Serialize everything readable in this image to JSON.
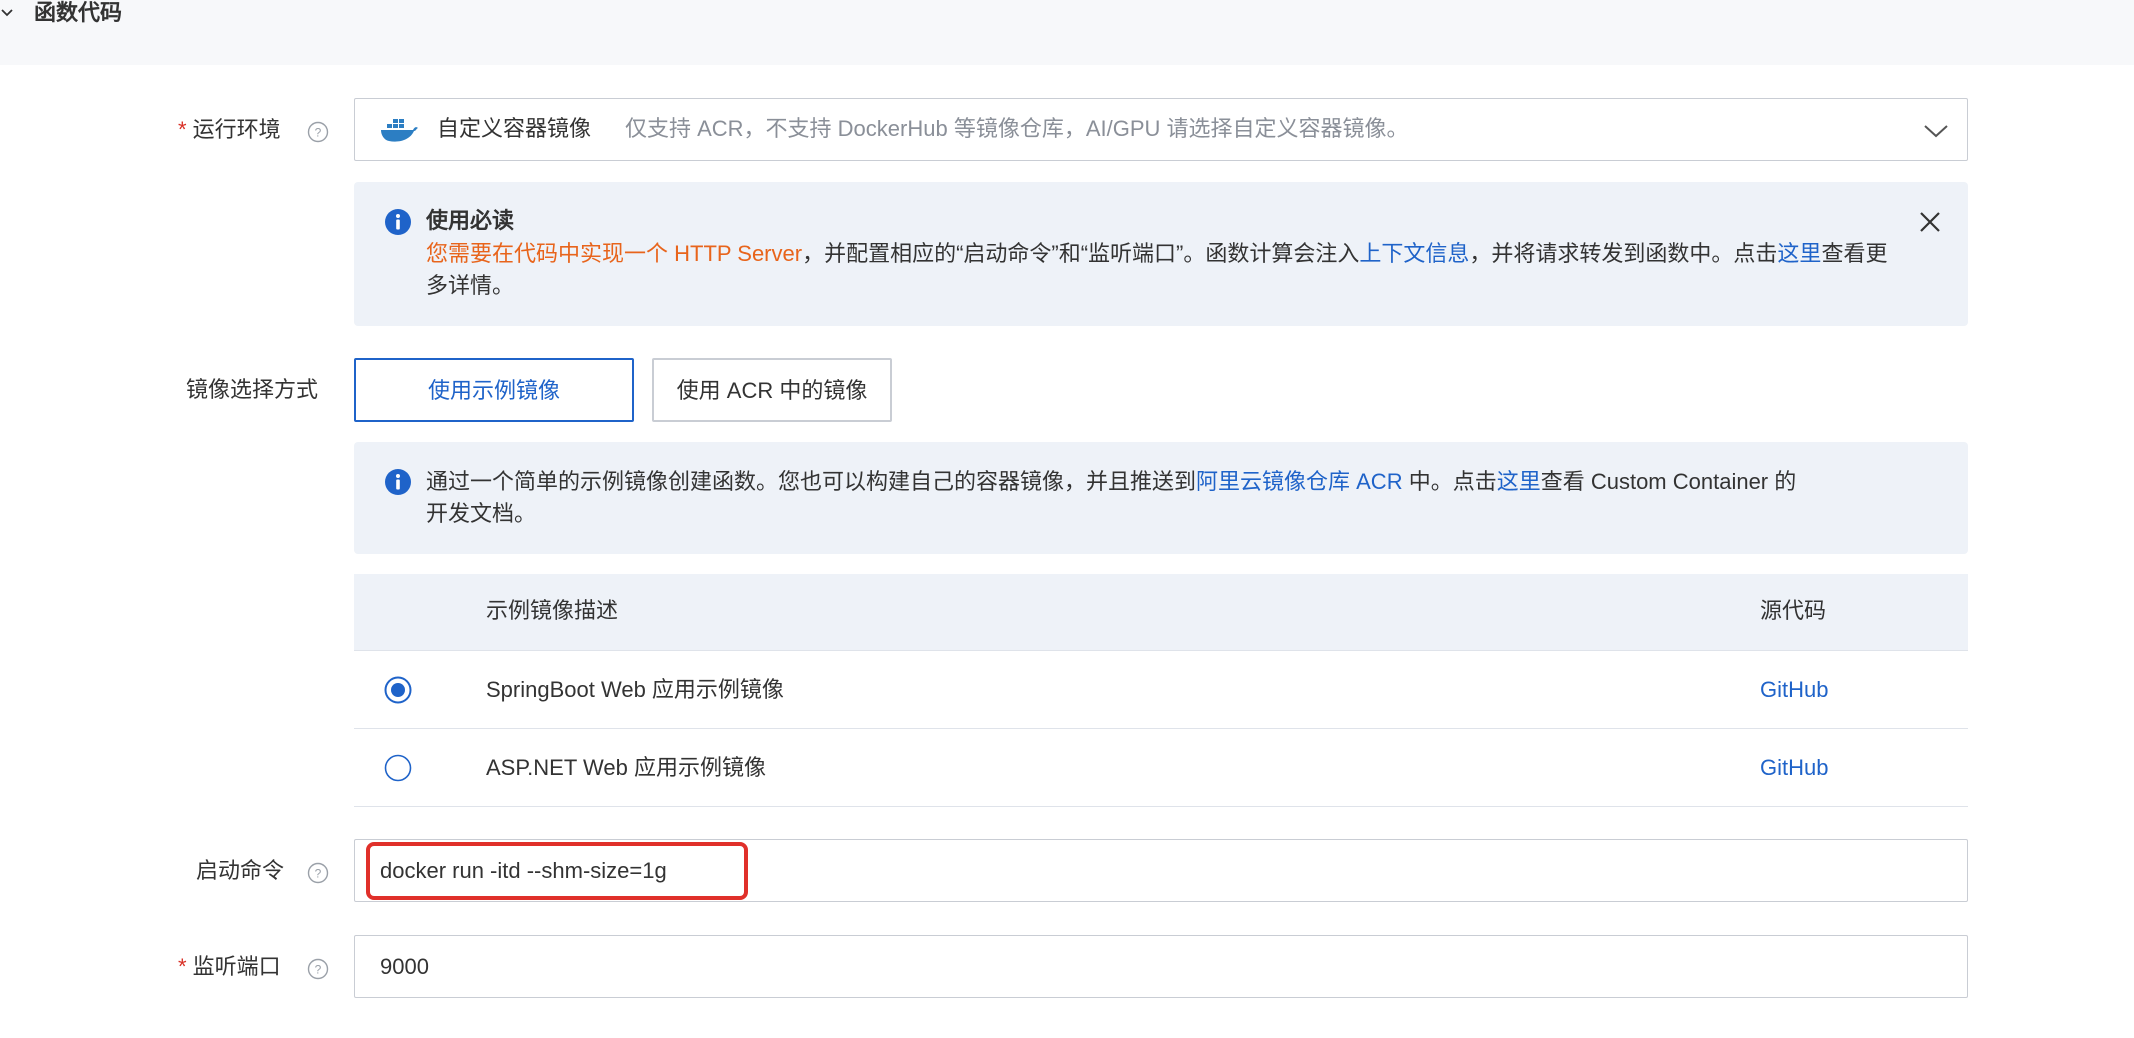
{
  "section": {
    "title": "函数代码"
  },
  "runtime": {
    "label": "运行环境",
    "value": "自定义容器镜像",
    "hint": "仅支持 ACR，不支持 DockerHub 等镜像仓库，AI/GPU 请选择自定义容器镜像。",
    "icon": "docker-icon"
  },
  "must_read": {
    "title": "使用必读",
    "text_orange": "您需要在代码中实现一个 HTTP Server",
    "text_1": "，并配置相应的“启动命令”和“监听端口”。函数计算会注入",
    "link_1": "上下文信息",
    "text_2": "，并将请求转发到函数中。点击",
    "link_2": "这里",
    "text_3": "查看更多详情。"
  },
  "image_select": {
    "label": "镜像选择方式",
    "options": [
      "使用示例镜像",
      "使用 ACR 中的镜像"
    ],
    "selected": "使用示例镜像"
  },
  "sample_notice": {
    "text_1": "通过一个简单的示例镜像创建函数。您也可以构建自己的容器镜像，并且推送到",
    "link_1": "阿里云镜像仓库 ACR",
    "text_2": " 中。点击",
    "link_2": "这里",
    "text_3": "查看 Custom Container 的",
    "text_4": "开发文档。"
  },
  "sample_table": {
    "columns": [
      "示例镜像描述",
      "源代码"
    ],
    "rows": [
      {
        "description": "SpringBoot Web 应用示例镜像",
        "source": "GitHub",
        "selected": true
      },
      {
        "description": "ASP.NET Web 应用示例镜像",
        "source": "GitHub",
        "selected": false
      }
    ]
  },
  "start_command": {
    "label": "启动命令",
    "value": "docker run -itd --shm-size=1g"
  },
  "listen_port": {
    "label": "监听端口",
    "value": "9000"
  },
  "colors": {
    "accent": "#1f63c9",
    "warning": "#e8641b",
    "required": "#d93026",
    "highlight": "#e0302a"
  }
}
